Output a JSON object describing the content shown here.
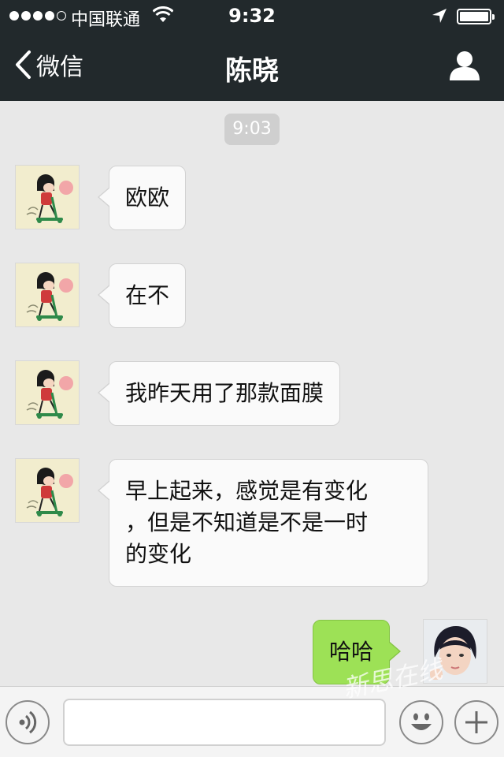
{
  "status_bar": {
    "carrier": "中国联通",
    "time": "9:32"
  },
  "nav": {
    "back_label": "微信",
    "title": "陈晓",
    "profile_icon": "person-icon"
  },
  "chat": {
    "timestamp": "9:03",
    "messages": [
      {
        "from": "contact",
        "text": "欧欧"
      },
      {
        "from": "contact",
        "text": "在不"
      },
      {
        "from": "contact",
        "text": "我昨天用了那款面膜"
      },
      {
        "from": "contact",
        "lines": [
          "早上起来，感觉是有变化",
          "，但是不知道是不是一时",
          "的变化"
        ]
      },
      {
        "from": "me",
        "text": "哈哈"
      }
    ]
  },
  "input_bar": {
    "voice_icon": "voice-icon",
    "text_value": "",
    "emoji_icon": "emoji-icon",
    "plus_icon": "plus-icon"
  },
  "watermark": "新思在线",
  "colors": {
    "nav_bg": "#22292c",
    "chat_bg": "#e8e8e8",
    "my_bubble": "#9de156",
    "their_bubble": "#fafafa"
  }
}
